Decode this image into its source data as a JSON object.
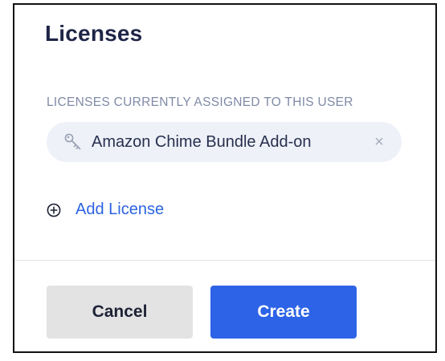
{
  "dialog": {
    "title": "Licenses",
    "section_label": "LICENSES CURRENTLY ASSIGNED TO THIS USER",
    "assigned_licenses": [
      {
        "label": "Amazon Chime Bundle Add-on",
        "icon": "key-icon",
        "remove_icon": "close-icon",
        "remove_glyph": "×"
      }
    ],
    "add_license": {
      "label": "Add License",
      "icon": "plus-circle-icon"
    },
    "buttons": {
      "cancel_label": "Cancel",
      "create_label": "Create"
    }
  },
  "colors": {
    "title": "#1f2547",
    "section_label": "#7f8aa6",
    "chip_background": "#eef1f8",
    "link": "#2b63e0",
    "primary_button": "#2d63e6",
    "secondary_button": "#e3e3e3"
  }
}
